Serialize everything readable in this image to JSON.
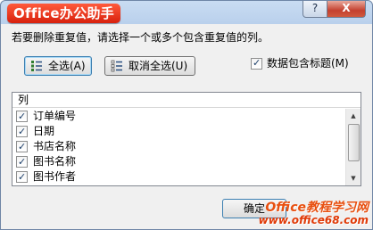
{
  "app": {
    "logo_text": "Office办公助手"
  },
  "titlebar": {
    "help_label": "?",
    "close_label": "X"
  },
  "instruction": "若要删除重复值，请选择一个或多个包含重复值的列。",
  "buttons": {
    "select_all": "全选(A)",
    "unselect_all": "取消全选(U)",
    "ok": "确定"
  },
  "header_checkbox": {
    "label": "数据包含标题(M)",
    "checked": true
  },
  "list": {
    "header": "列",
    "items": [
      {
        "label": "订单编号",
        "checked": true
      },
      {
        "label": "日期",
        "checked": true
      },
      {
        "label": "书店名称",
        "checked": true
      },
      {
        "label": "图书名称",
        "checked": true
      },
      {
        "label": "图书作者",
        "checked": true
      }
    ]
  },
  "watermark": {
    "line1": "Office教程学习网",
    "line2": "www.office68.com"
  },
  "colors": {
    "accent": "#3c7fb1",
    "logo_bg": "#e0301a",
    "watermark": "#e85010"
  },
  "icons": [
    "help-icon",
    "close-icon",
    "select-all-icon",
    "unselect-all-icon",
    "scroll-up-icon",
    "scroll-down-icon"
  ]
}
